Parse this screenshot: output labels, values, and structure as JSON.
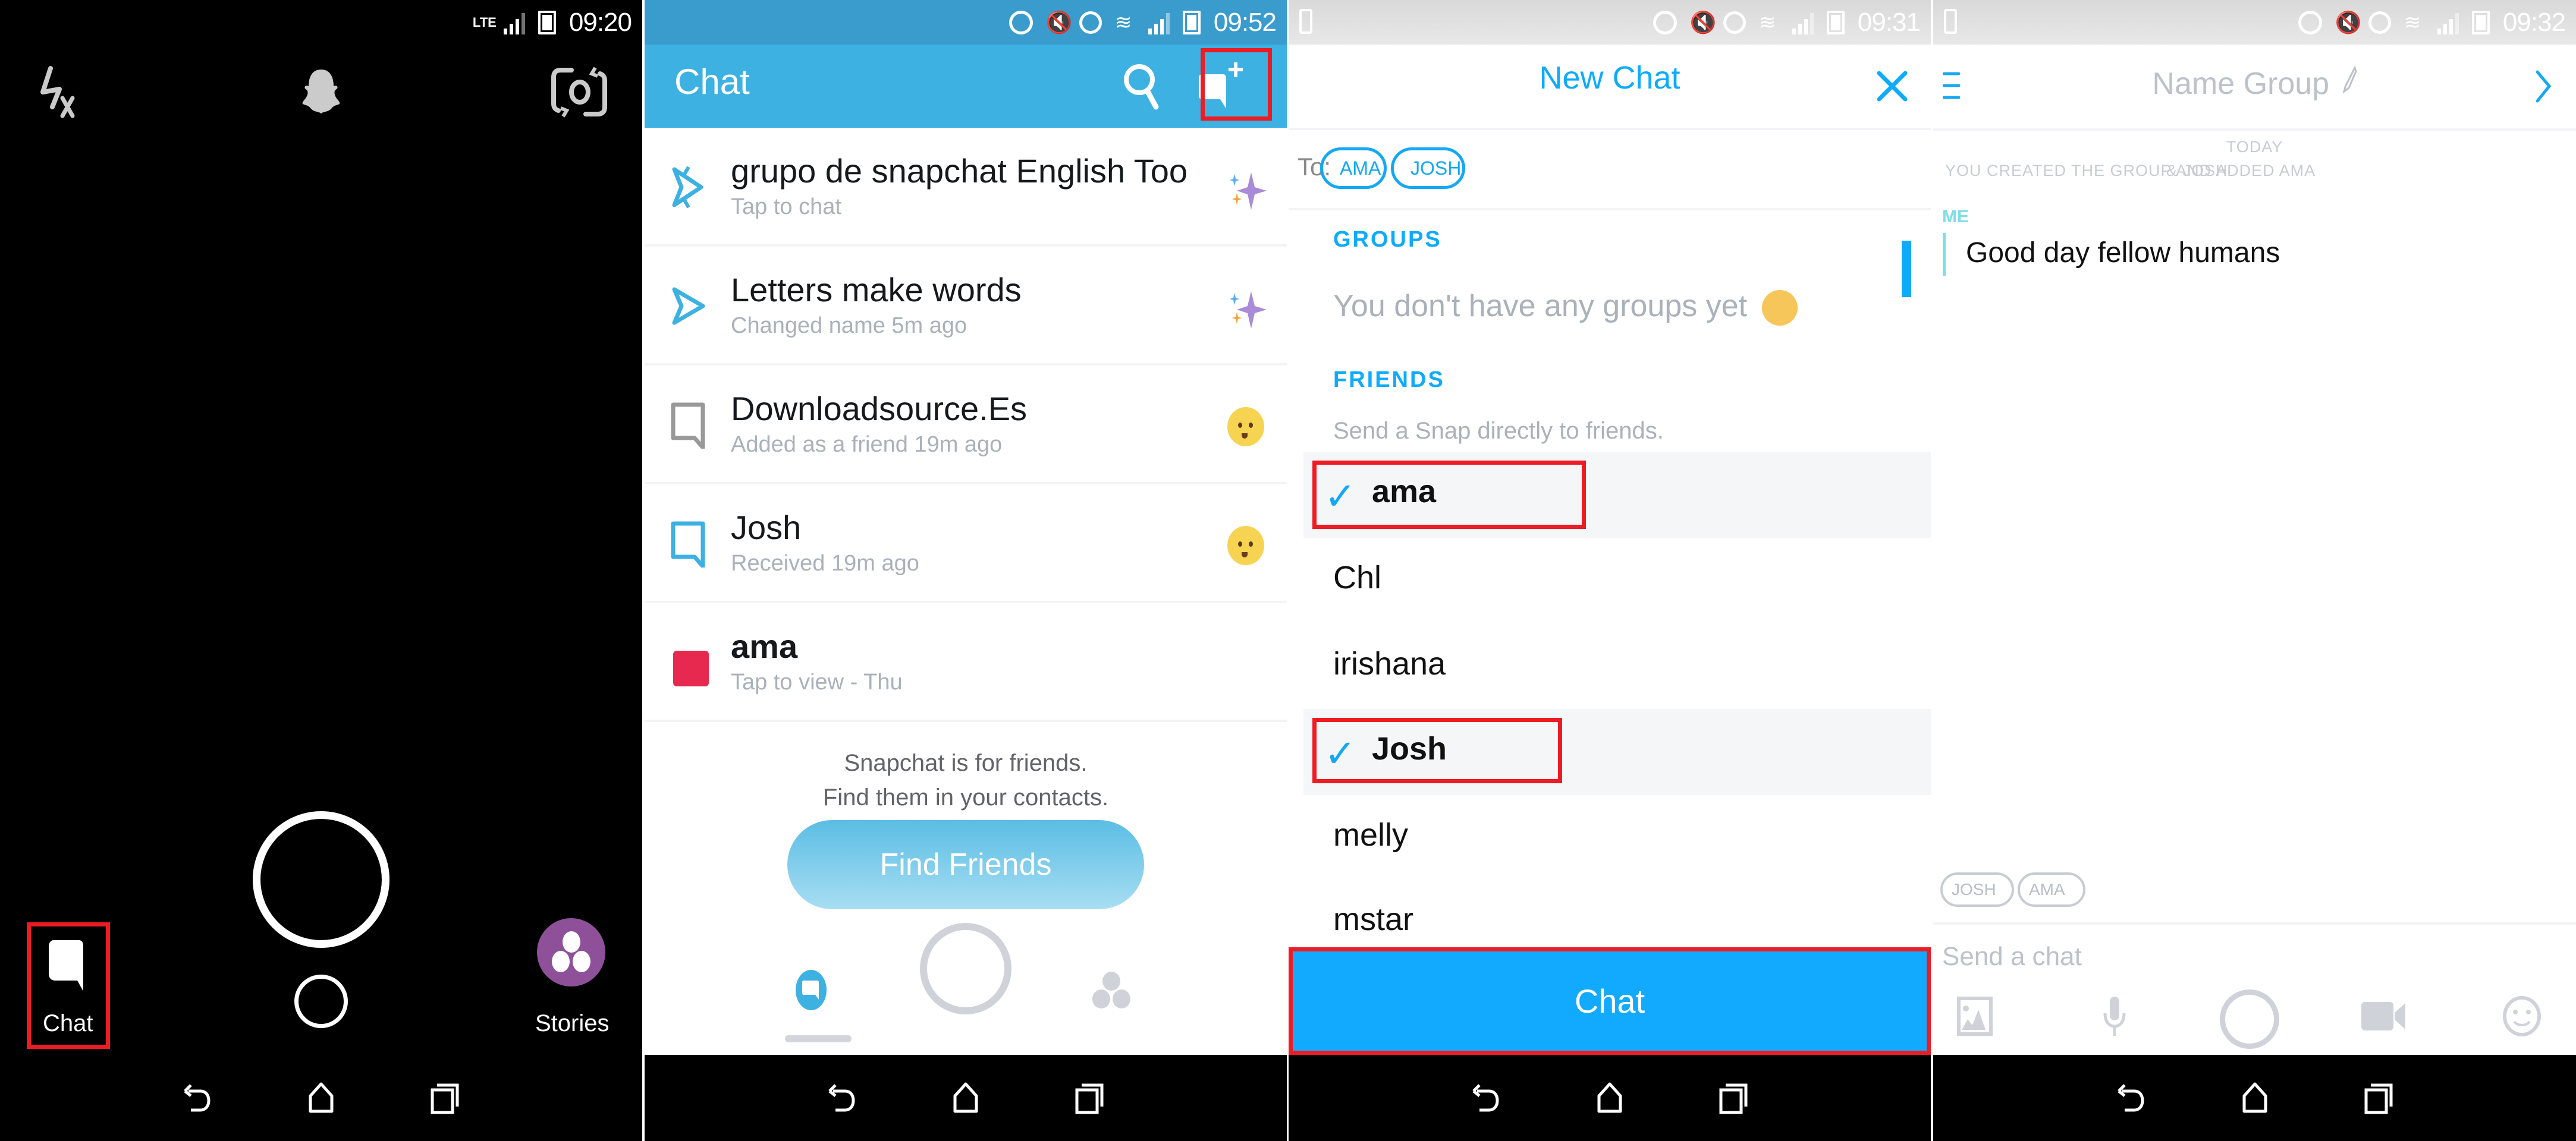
{
  "colors": {
    "snap_blue": "#3db1e2",
    "accent_blue": "#0fabfb",
    "chat_button_blue": "#12aafe",
    "highlight_red": "#ec1c24",
    "stories_purple": "#8f509a",
    "snap_red": "#e8294f",
    "muted_grey": "#a9b1ba"
  },
  "panel1": {
    "status": {
      "network": "LTE",
      "time": "09:20"
    },
    "icons": [
      "flash-off-icon",
      "ghost-icon",
      "flip-camera-icon"
    ],
    "chat_label": "Chat",
    "stories_label": "Stories"
  },
  "panel2": {
    "status": {
      "time": "09:52"
    },
    "header": {
      "title": "Chat"
    },
    "chats": [
      {
        "name": "grupo de snapchat English Too",
        "subtitle": "Tap to chat",
        "icon": "group-chat-icon",
        "trail": "sparkles-icon"
      },
      {
        "name": "Letters make words",
        "subtitle": "Changed name 5m ago",
        "icon": "sent-arrow-icon",
        "trail": "sparkles-icon"
      },
      {
        "name": "Downloadsource.Es",
        "subtitle": "Added as a friend 19m ago",
        "icon": "chat-outline-grey-icon",
        "trail": "baby-emoji-icon"
      },
      {
        "name": "Josh",
        "subtitle": "Received 19m ago",
        "icon": "chat-outline-blue-icon",
        "trail": "baby-emoji-icon"
      },
      {
        "name": "ama",
        "subtitle": "Tap to view - Thu",
        "icon": "snap-red-square-icon",
        "trail": ""
      }
    ],
    "empty_line1": "Snapchat is for friends.",
    "empty_line2": "Find them in your contacts.",
    "find_friends_label": "Find Friends"
  },
  "panel3": {
    "status": {
      "time": "09:31"
    },
    "header": {
      "title": "New Chat"
    },
    "to_label": "To:",
    "recipients": [
      "AMA",
      "JOSH"
    ],
    "groups_heading": "GROUPS",
    "groups_empty": "You don't have any groups yet",
    "friends_heading": "FRIENDS",
    "friends_hint": "Send a Snap directly to friends.",
    "friends": [
      {
        "name": "ama",
        "selected": true
      },
      {
        "name": "Chl",
        "selected": false
      },
      {
        "name": "irishana",
        "selected": false
      },
      {
        "name": "Josh",
        "selected": true
      },
      {
        "name": "melly",
        "selected": false
      },
      {
        "name": "mstar",
        "selected": false
      }
    ],
    "chat_button_label": "Chat"
  },
  "panel4": {
    "status": {
      "time": "09:32"
    },
    "header": {
      "title": "Name Group"
    },
    "today_label": "TODAY",
    "system_msg_part1": "YOU CREATED THE GROUP AND ADDED AMA",
    "system_msg_part2": "& JOSH",
    "sender_label": "ME",
    "message": "Good day fellow humans",
    "members": [
      "JOSH",
      "AMA"
    ],
    "input_placeholder": "Send a chat"
  }
}
